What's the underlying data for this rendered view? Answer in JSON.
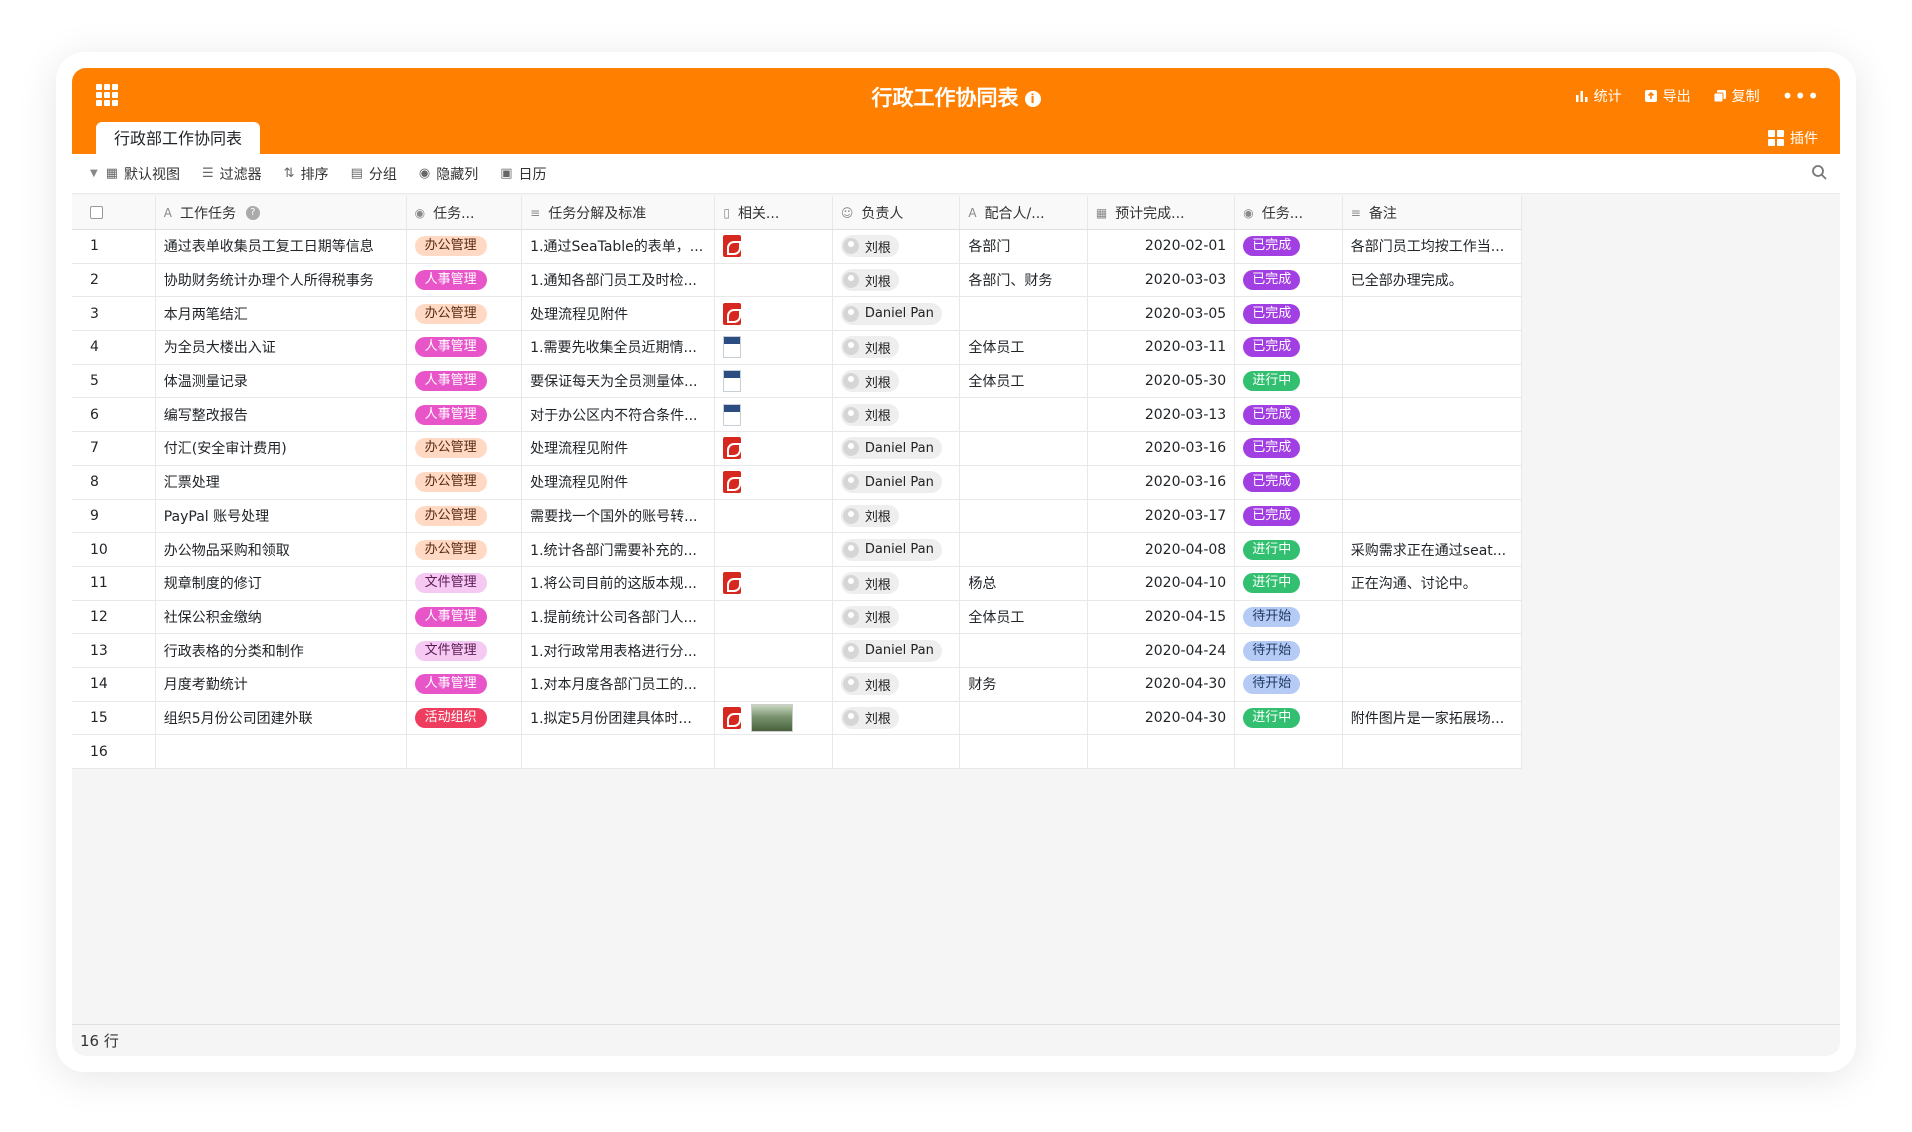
{
  "header": {
    "title": "行政工作协同表",
    "actions": [
      {
        "icon": "bar-chart-icon",
        "label": "统计"
      },
      {
        "icon": "export-icon",
        "label": "导出"
      },
      {
        "icon": "copy-icon",
        "label": "复制"
      }
    ],
    "more": "•••"
  },
  "tab": {
    "label": "行政部工作协同表"
  },
  "plugin": {
    "label": "插件"
  },
  "toolbar": {
    "view_label": "默认视图",
    "filter_label": "过滤器",
    "sort_label": "排序",
    "group_label": "分组",
    "hide_label": "隐藏列",
    "calendar_label": "日历"
  },
  "columns": [
    "工作任务",
    "任务...",
    "任务分解及标准",
    "相关...",
    "负责人",
    "配合人/...",
    "预计完成...",
    "任务...",
    "备注"
  ],
  "rows": [
    {
      "n": "1",
      "task": "通过表单收集员工复工日期等信息",
      "cat": "办公管理",
      "cat_type": "office",
      "detail": "1.通过SeaTable的表单，...",
      "files": [
        "pdf"
      ],
      "owner": "刘根",
      "partner": "各部门",
      "date": "2020-02-01",
      "status": "已完成",
      "status_type": "done",
      "note": "各部门员工均按工作当..."
    },
    {
      "n": "2",
      "task": "协助财务统计办理个人所得税事务",
      "cat": "人事管理",
      "cat_type": "hr",
      "detail": "1.通知各部门员工及时检...",
      "files": [],
      "owner": "刘根",
      "partner": "各部门、财务",
      "date": "2020-03-03",
      "status": "已完成",
      "status_type": "done",
      "note": "已全部办理完成。"
    },
    {
      "n": "3",
      "task": "本月两笔结汇",
      "cat": "办公管理",
      "cat_type": "office",
      "detail": "处理流程见附件",
      "files": [
        "pdf"
      ],
      "owner": "Daniel Pan",
      "partner": "",
      "date": "2020-03-05",
      "status": "已完成",
      "status_type": "done",
      "note": ""
    },
    {
      "n": "4",
      "task": "为全员大楼出入证",
      "cat": "人事管理",
      "cat_type": "hr",
      "detail": "1.需要先收集全员近期情...",
      "files": [
        "doc"
      ],
      "owner": "刘根",
      "partner": "全体员工",
      "date": "2020-03-11",
      "status": "已完成",
      "status_type": "done",
      "note": ""
    },
    {
      "n": "5",
      "task": "体温测量记录",
      "cat": "人事管理",
      "cat_type": "hr",
      "detail": "要保证每天为全员测量体...",
      "files": [
        "doc"
      ],
      "owner": "刘根",
      "partner": "全体员工",
      "date": "2020-05-30",
      "status": "进行中",
      "status_type": "doing",
      "note": ""
    },
    {
      "n": "6",
      "task": "编写整改报告",
      "cat": "人事管理",
      "cat_type": "hr",
      "detail": "对于办公区内不符合条件...",
      "files": [
        "doc"
      ],
      "owner": "刘根",
      "partner": "",
      "date": "2020-03-13",
      "status": "已完成",
      "status_type": "done",
      "note": ""
    },
    {
      "n": "7",
      "task": "付汇(安全审计费用)",
      "cat": "办公管理",
      "cat_type": "office",
      "detail": "处理流程见附件",
      "files": [
        "pdf"
      ],
      "owner": "Daniel Pan",
      "partner": "",
      "date": "2020-03-16",
      "status": "已完成",
      "status_type": "done",
      "note": ""
    },
    {
      "n": "8",
      "task": "汇票处理",
      "cat": "办公管理",
      "cat_type": "office",
      "detail": "处理流程见附件",
      "files": [
        "pdf"
      ],
      "owner": "Daniel Pan",
      "partner": "",
      "date": "2020-03-16",
      "status": "已完成",
      "status_type": "done",
      "note": ""
    },
    {
      "n": "9",
      "task": "PayPal 账号处理",
      "cat": "办公管理",
      "cat_type": "office",
      "detail": "需要找一个国外的账号转...",
      "files": [],
      "owner": "刘根",
      "partner": "",
      "date": "2020-03-17",
      "status": "已完成",
      "status_type": "done",
      "note": ""
    },
    {
      "n": "10",
      "task": "办公物品采购和领取",
      "cat": "办公管理",
      "cat_type": "office",
      "detail": "1.统计各部门需要补充的...",
      "files": [],
      "owner": "Daniel Pan",
      "partner": "",
      "date": "2020-04-08",
      "status": "进行中",
      "status_type": "doing",
      "note": "采购需求正在通过seat..."
    },
    {
      "n": "11",
      "task": "规章制度的修订",
      "cat": "文件管理",
      "cat_type": "doc",
      "detail": "1.将公司目前的这版本规...",
      "files": [
        "pdf"
      ],
      "owner": "刘根",
      "partner": "杨总",
      "date": "2020-04-10",
      "status": "进行中",
      "status_type": "doing",
      "note": "正在沟通、讨论中。"
    },
    {
      "n": "12",
      "task": "社保公积金缴纳",
      "cat": "人事管理",
      "cat_type": "hr",
      "detail": "1.提前统计公司各部门人...",
      "files": [],
      "owner": "刘根",
      "partner": "全体员工",
      "date": "2020-04-15",
      "status": "待开始",
      "status_type": "todo",
      "note": ""
    },
    {
      "n": "13",
      "task": "行政表格的分类和制作",
      "cat": "文件管理",
      "cat_type": "doc",
      "detail": "1.对行政常用表格进行分...",
      "files": [],
      "owner": "Daniel Pan",
      "partner": "",
      "date": "2020-04-24",
      "status": "待开始",
      "status_type": "todo",
      "note": ""
    },
    {
      "n": "14",
      "task": "月度考勤统计",
      "cat": "人事管理",
      "cat_type": "hr",
      "detail": "1.对本月度各部门员工的...",
      "files": [],
      "owner": "刘根",
      "partner": "财务",
      "date": "2020-04-30",
      "status": "待开始",
      "status_type": "todo",
      "note": ""
    },
    {
      "n": "15",
      "task": "组织5月份公司团建外联",
      "cat": "活动组织",
      "cat_type": "event",
      "detail": "1.拟定5月份团建具体时...",
      "files": [
        "pdf",
        "image"
      ],
      "owner": "刘根",
      "partner": "",
      "date": "2020-04-30",
      "status": "进行中",
      "status_type": "doing",
      "note": "附件图片是一家拓展场..."
    },
    {
      "n": "16",
      "task": "",
      "cat": "",
      "cat_type": "",
      "detail": "",
      "files": [],
      "owner": "",
      "partner": "",
      "date": "",
      "status": "",
      "status_type": "",
      "note": ""
    }
  ],
  "footer": {
    "row_count": "16 行"
  },
  "colors": {
    "brand": "#ff8000",
    "done": "#a23fe3",
    "doing": "#33bf70",
    "todo": "#b5cbf5"
  }
}
